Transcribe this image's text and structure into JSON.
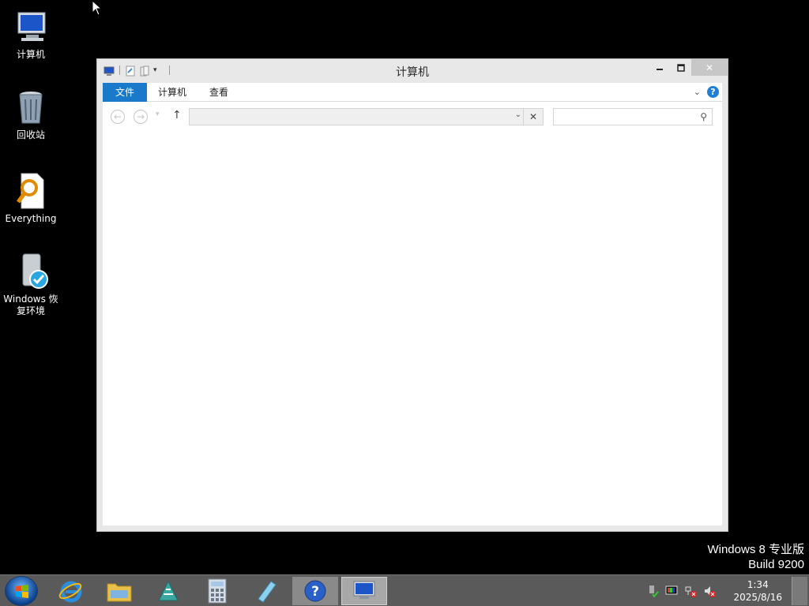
{
  "desktop": {
    "icons": [
      {
        "label": "计算机",
        "icon": "computer-icon"
      },
      {
        "label": "回收站",
        "icon": "recycle-bin-icon"
      },
      {
        "label": "Everything",
        "icon": "everything-search-icon"
      },
      {
        "label": "Windows 恢复环境",
        "icon": "recovery-environment-icon"
      }
    ],
    "watermark": {
      "line1": "Windows 8 专业版",
      "line2": "Build 9200"
    }
  },
  "window": {
    "title": "计算机",
    "tabs": [
      {
        "label": "文件"
      },
      {
        "label": "计算机"
      },
      {
        "label": "查看"
      }
    ],
    "address": {
      "value": ""
    },
    "search": {
      "placeholder": ""
    }
  },
  "taskbar": {
    "apps": [
      {
        "name": "internet-explorer",
        "icon": "ie-icon"
      },
      {
        "name": "file-explorer",
        "icon": "folder-icon"
      },
      {
        "name": "network",
        "icon": "network-icon"
      },
      {
        "name": "calculator",
        "icon": "calculator-icon"
      },
      {
        "name": "notes",
        "icon": "notepad-icon"
      },
      {
        "name": "help",
        "icon": "help-icon"
      },
      {
        "name": "computer",
        "icon": "computer-icon"
      }
    ],
    "clock": {
      "time": "1:34",
      "date": "2025/8/16"
    }
  },
  "colors": {
    "accent": "#1979ca",
    "taskbar": "#5a5a5a",
    "desktop": "#000000"
  }
}
